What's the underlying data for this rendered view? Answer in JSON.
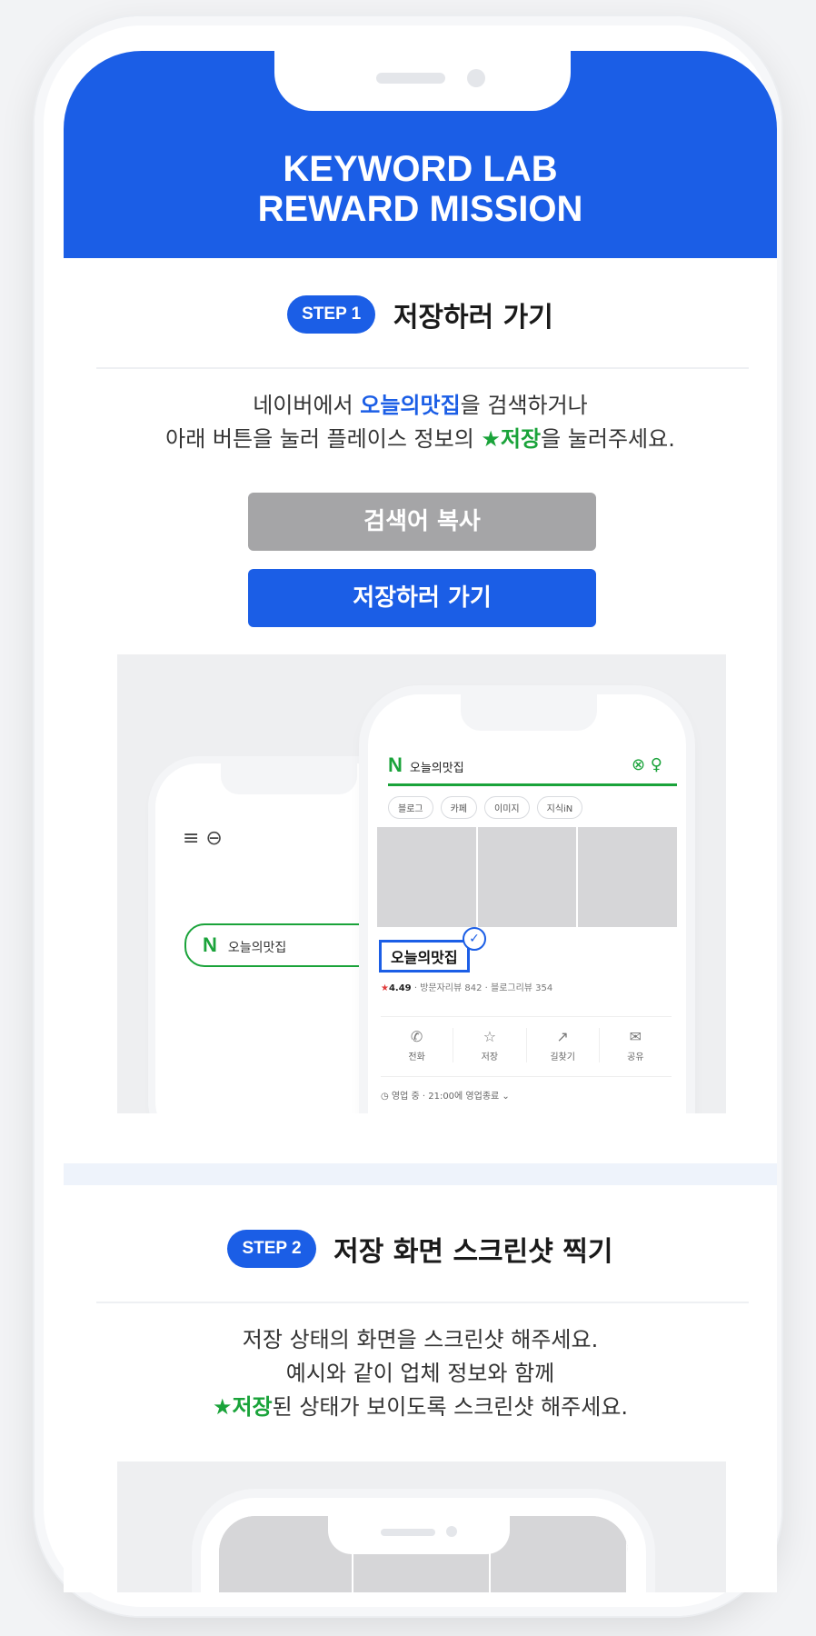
{
  "header": {
    "title_line1": "KEYWORD LAB",
    "title_line2": "REWARD MISSION"
  },
  "step1": {
    "badge": "STEP 1",
    "title": "저장하러 가기",
    "desc_line1_pre": "네이버에서 ",
    "desc_line1_highlight": "오늘의맛집",
    "desc_line1_post": "을 검색하거나",
    "desc_line2_pre": "아래 버튼을 눌러 플레이스 정보의 ",
    "desc_line2_highlight": "★저장",
    "desc_line2_post": "을 눌러주세요.",
    "copy_button": "검색어 복사",
    "go_button": "저장하러 가기"
  },
  "example1": {
    "back_phone_search": "오늘의맛집",
    "front_phone_search": "오늘의맛집",
    "chips": [
      "블로그",
      "카페",
      "이미지",
      "지식iN"
    ],
    "place_name": "오늘의맛집",
    "rating_value": "4.49",
    "rating_rest": " · 방문자리뷰 842 · 블로그리뷰 354",
    "actions": [
      {
        "icon": "✆",
        "label": "전화"
      },
      {
        "icon": "☆",
        "label": "저장"
      },
      {
        "icon": "↗",
        "label": "길찾기"
      },
      {
        "icon": "✉",
        "label": "공유"
      }
    ],
    "hours": "◷ 영업 중 · 21:00에 영업종료 ⌄"
  },
  "step2": {
    "badge": "STEP 2",
    "title": "저장 화면 스크린샷 찍기",
    "desc_line1": "저장 상태의 화면을 스크린샷 해주세요.",
    "desc_line2": "예시와 같이 업체 정보와 함께",
    "desc_line3_highlight": "★저장",
    "desc_line3_post": "된 상태가 보이도록 스크린샷 해주세요."
  },
  "colors": {
    "brand_blue": "#1b5ee6",
    "naver_green": "#1aa33a",
    "button_gray": "#a5a5a7"
  }
}
